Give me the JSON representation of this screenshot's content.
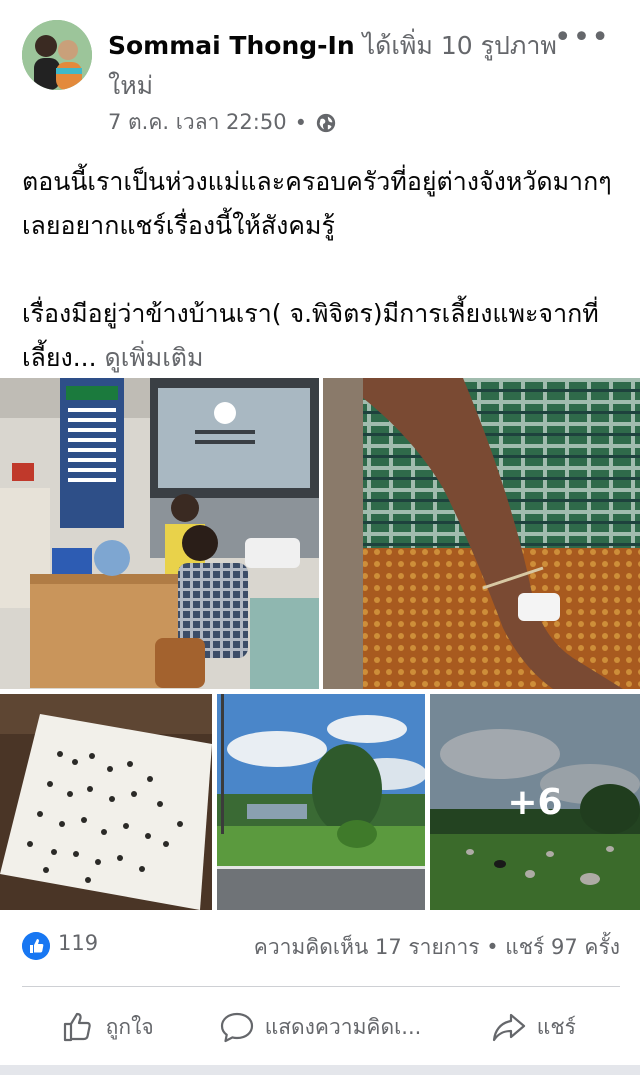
{
  "post": {
    "author": "Sommai Thong-In",
    "action": "ได้เพิ่ม 10 รูปภาพใหม่",
    "timestamp": "7 ต.ค. เวลา 22:50",
    "separator": "•",
    "privacy_icon": "globe-icon",
    "more_icon": "more-icon",
    "more_label": "•••"
  },
  "body": {
    "paragraph1": "ตอนนี้เราเป็นห่วงแม่และครอบครัวที่อยู่ต่างจังหวัดมากๆ เลยอยากแชร์เรื่องนี้ให้สังคมรู้",
    "paragraph2": "เรื่องมีอยู่ว่าข้างบ้านเรา( จ.พิจิตร)มีการเลี้ยงแพะจากที่เลี้ยง...",
    "see_more": "ดูเพิ่มเติม"
  },
  "photos": {
    "more_count": "+6"
  },
  "stats": {
    "likes": "119",
    "comments_shares": "ความคิดเห็น 17 รายการ • แชร์ 97 ครั้ง"
  },
  "actions": {
    "like": "ถูกใจ",
    "comment": "แสดงความคิดเ...",
    "share": "แชร์"
  },
  "colors": {
    "accent": "#1877f2",
    "secondary_text": "#65676b"
  }
}
